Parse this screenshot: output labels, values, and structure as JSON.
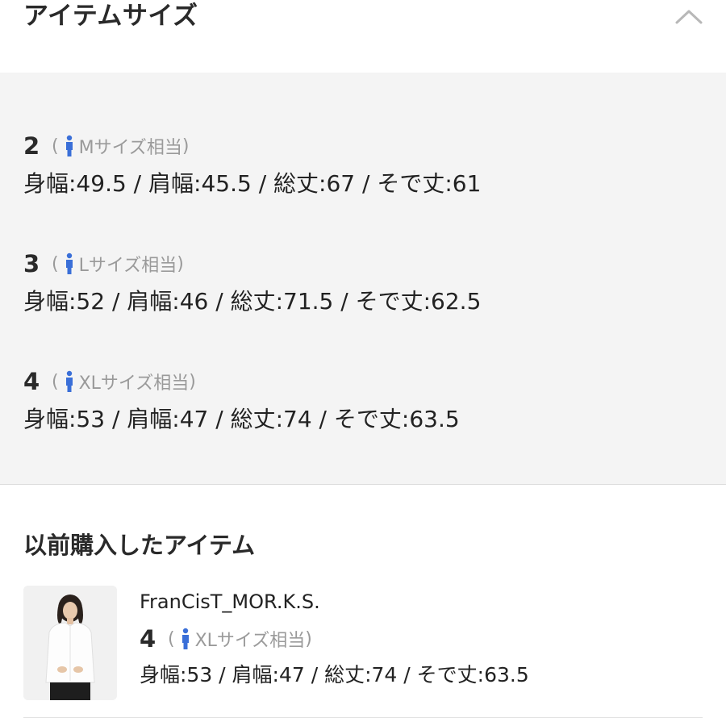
{
  "header": {
    "title": "アイテムサイズ",
    "collapse_icon": "chevron-up-icon"
  },
  "sizes": [
    {
      "size": "2",
      "equiv_open": "(",
      "equiv_label": "Mサイズ相当",
      "equiv_close": ")",
      "measurements": "身幅:49.5 / 肩幅:45.5 / 総丈:67 / そで丈:61"
    },
    {
      "size": "3",
      "equiv_open": "(",
      "equiv_label": "Lサイズ相当",
      "equiv_close": ")",
      "measurements": "身幅:52 / 肩幅:46 / 総丈:71.5 / そで丈:62.5"
    },
    {
      "size": "4",
      "equiv_open": "(",
      "equiv_label": "XLサイズ相当",
      "equiv_close": ")",
      "measurements": "身幅:53 / 肩幅:47 / 総丈:74 / そで丈:63.5"
    }
  ],
  "history": {
    "title": "以前購入したアイテム",
    "item": {
      "brand": "FranCisT_MOR.K.S.",
      "size": "4",
      "equiv_open": "(",
      "equiv_label": "XLサイズ相当",
      "equiv_close": ")",
      "measurements": "身幅:53 / 肩幅:47 / 総丈:74 / そで丈:63.5"
    }
  },
  "colors": {
    "person_icon": "#3a6fd8",
    "panel_bg": "#f4f4f4",
    "muted_text": "#9a9a9a"
  }
}
